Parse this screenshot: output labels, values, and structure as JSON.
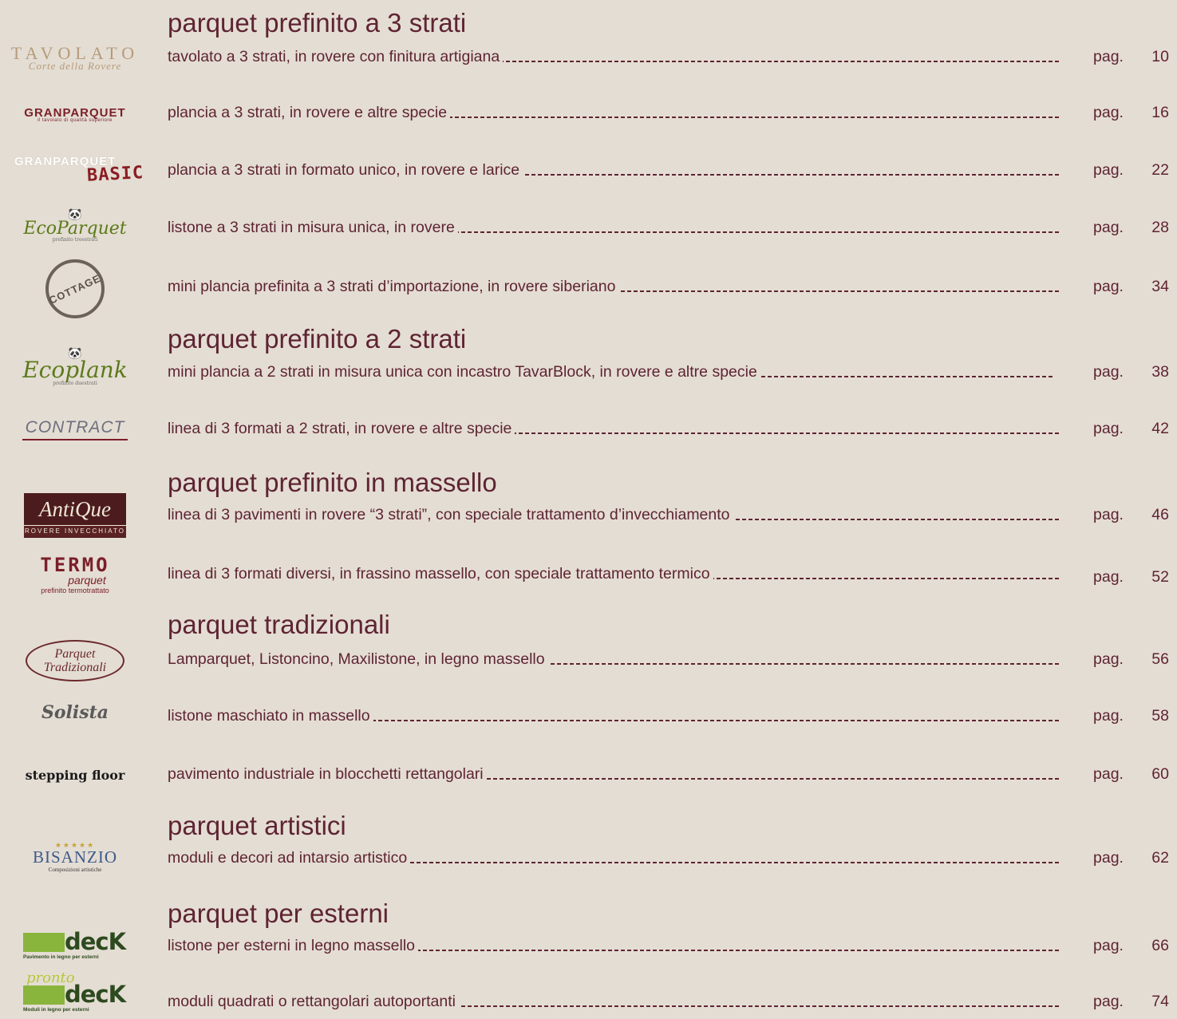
{
  "sections": [
    {
      "heading": "parquet prefinito a 3 strati"
    },
    {
      "heading": "parquet prefinito a 2 strati"
    },
    {
      "heading": "parquet prefinito in massello"
    },
    {
      "heading": "parquet tradizionali"
    },
    {
      "heading": "parquet artistici"
    },
    {
      "heading": "parquet per esterni"
    }
  ],
  "entries": [
    {
      "logo": "TAVOLATO",
      "logo_sub": "Corte della Rovere",
      "desc": "tavolato a 3 strati, in rovere con finitura artigiana",
      "pag": "pag.",
      "page": "10"
    },
    {
      "logo": "GRANPARQUET",
      "logo_sub": "il tavolato di qualità superiore",
      "desc": "plancia a 3 strati, in rovere e altre specie",
      "pag": "pag.",
      "page": "16"
    },
    {
      "logo": "GRANPARQUET",
      "logo_sub": "BASIC",
      "desc": "plancia a 3 strati in formato unico, in rovere e larice",
      "pag": "pag.",
      "page": "22"
    },
    {
      "logo": "EcoParquet",
      "logo_sub": "prefinito treestrati",
      "desc": "listone a 3 strati in misura unica, in rovere",
      "pag": "pag.",
      "page": "28"
    },
    {
      "logo": "COTTAGE",
      "desc": "mini plancia prefinita a 3 strati d’importazione, in rovere siberiano",
      "pag": "pag.",
      "page": "34"
    },
    {
      "logo": "Ecoplank",
      "logo_sub": "prefinito duestrati",
      "desc": "mini plancia a 2 strati in misura unica con incastro TavarBlock, in rovere e altre specie",
      "pag": "pag.",
      "page": "38"
    },
    {
      "logo": "CONTRACT",
      "desc": "linea di 3 formati a 2 strati, in rovere e altre specie",
      "pag": "pag.",
      "page": "42"
    },
    {
      "logo": "AntiQue",
      "logo_sub": "ROVERE INVECCHIATO",
      "desc": "linea di 3 pavimenti in rovere “3 strati”, con speciale trattamento d’invecchiamento",
      "pag": "pag.",
      "page": "46"
    },
    {
      "logo": "TERMO",
      "logo_mid": "parquet",
      "logo_sub": "prefinito termotrattato",
      "desc": "linea di 3 formati diversi, in frassino massello, con speciale trattamento termico",
      "pag": "pag.",
      "page": "52"
    },
    {
      "logo": "Parquet",
      "logo_sub": "Tradizionali",
      "desc": "Lamparquet, Listoncino, Maxilistone, in legno massello",
      "pag": "pag.",
      "page": "56"
    },
    {
      "logo": "Solista",
      "desc": "listone maschiato in massello",
      "pag": "pag.",
      "page": "58"
    },
    {
      "logo": "stepping floor",
      "desc": "pavimento industriale in blocchetti rettangolari",
      "pag": "pag.",
      "page": "60"
    },
    {
      "logo": "BISANZIO",
      "logo_sub": "Composizioni artistiche",
      "desc": "moduli e decori ad intarsio artistico",
      "pag": "pag.",
      "page": "62"
    },
    {
      "logo": "decK",
      "logo_sub": "Pavimento in legno per esterni",
      "desc": "listone per esterni in legno massello",
      "pag": "pag.",
      "page": "66"
    },
    {
      "logo": "decK",
      "logo_top": "pronto",
      "logo_sub": "Moduli in legno per esterni",
      "desc": "moduli quadrati o rettangolari autoportanti",
      "pag": "pag.",
      "page": "74"
    }
  ],
  "colors": {
    "background": "#e4ddd3",
    "text": "#5e2433"
  }
}
